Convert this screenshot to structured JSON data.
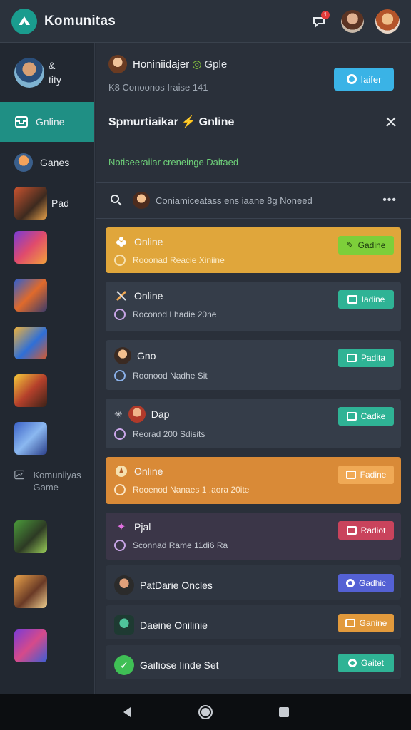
{
  "app": {
    "title": "Komunitas"
  },
  "topbar": {
    "notification_count": "1"
  },
  "sidebar": {
    "profile": {
      "line1": "&",
      "line2": "tity"
    },
    "items": [
      {
        "label": "Gnline",
        "active": true
      },
      {
        "label": "Ganes"
      },
      {
        "label": "Pad"
      }
    ],
    "section_label": "Komuniiyas Game"
  },
  "main": {
    "header": {
      "name": "Honiniidajer",
      "tag": "Gple",
      "subtitle": "K8 Conoonos Iraise 141",
      "button": "Iaifer"
    },
    "section_title": "Spmurtiaikar ⚡ Gnline",
    "notice": "Notiseeraiiar creneinge Daitaed",
    "search": {
      "query": "Coniamiceatass ens iaane 8g Noneed",
      "more": "•••"
    },
    "cards": [
      {
        "title": "Online",
        "subtitle": "Rooonad Reacie Xiniine",
        "chip": "Gadine",
        "style": "yellow"
      },
      {
        "title": "Online",
        "subtitle": "Roconod Lhadie 20ne",
        "chip": "Iadine",
        "style": "slate"
      },
      {
        "title": "Gno",
        "subtitle": "Roonood Nadhe Sit",
        "chip": "Padita",
        "style": "slate"
      },
      {
        "title": "Dap",
        "subtitle": "Reorad 200 Sdisits",
        "chip": "Cadke",
        "style": "slate"
      },
      {
        "title": "Online",
        "subtitle": "Rooenod Nanaes 1 .aora 20ite",
        "chip": "Fadine",
        "style": "orange"
      },
      {
        "title": "Pjal",
        "subtitle": "Sconnad Rame 11di6 Ra",
        "chip": "Radiot",
        "style": "plum"
      }
    ],
    "rows": [
      {
        "title": "PatDarie Oncles",
        "chip": "Gadhic"
      },
      {
        "title": "Daeine Onilinie",
        "chip": "Ganine"
      },
      {
        "title": "Gaifiose Iinde Set",
        "chip": "Gaitet"
      }
    ]
  },
  "colors": {
    "accent": "#1f8f84",
    "blue_button": "#3ab3e6",
    "notice": "#6fd27a"
  }
}
